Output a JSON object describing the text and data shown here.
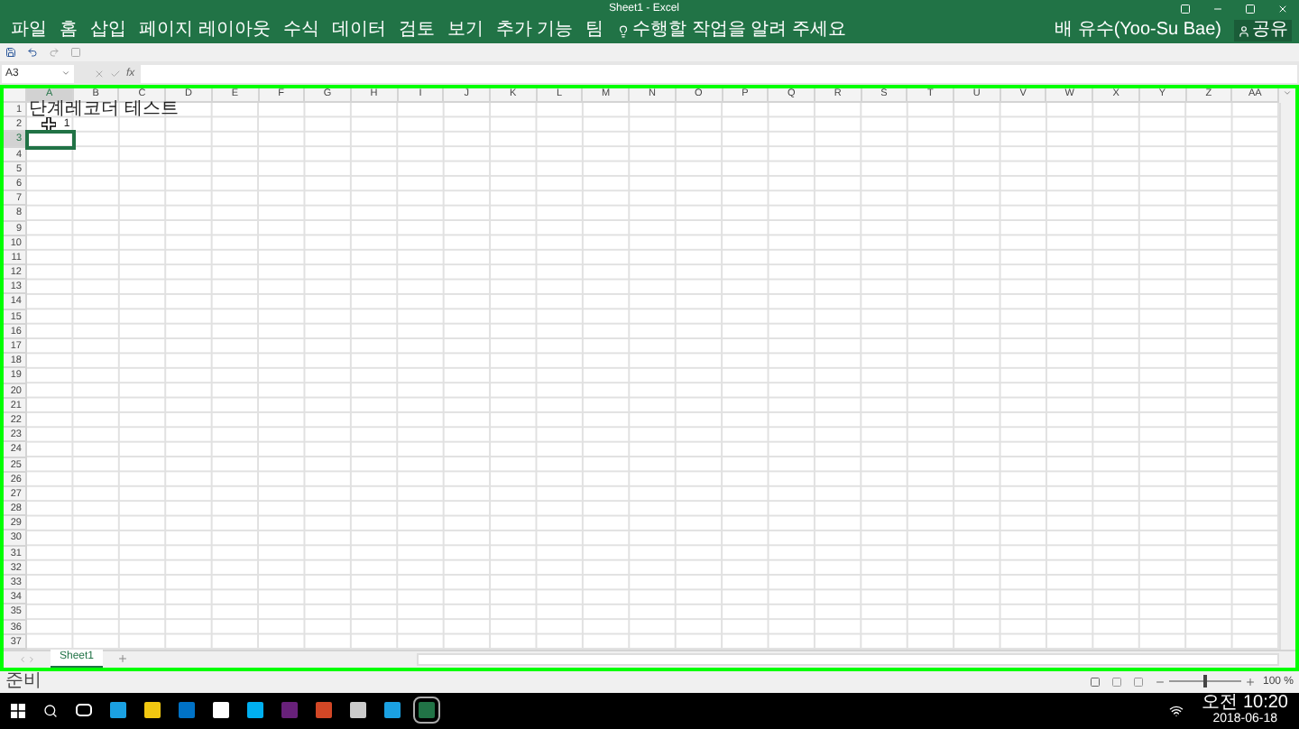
{
  "window": {
    "title": "Sheet1 - Excel",
    "user": "배 유수(Yoo-Su Bae)",
    "share": "공유"
  },
  "ribbon_tabs": [
    "파일",
    "홈",
    "삽입",
    "페이지 레이아웃",
    "수식",
    "데이터",
    "검토",
    "보기",
    "추가 기능",
    "팀"
  ],
  "tell_me": "수행할 작업을 알려 주세요",
  "name_box": "A3",
  "function_label": "fx",
  "columns": [
    {
      "label": "A",
      "selected": true
    },
    {
      "label": "B",
      "selected": false
    },
    {
      "label": "C",
      "selected": false
    },
    {
      "label": "D",
      "selected": false
    },
    {
      "label": "E",
      "selected": false
    },
    {
      "label": "F",
      "selected": false
    },
    {
      "label": "G",
      "selected": false
    },
    {
      "label": "H",
      "selected": false
    },
    {
      "label": "I",
      "selected": false
    },
    {
      "label": "J",
      "selected": false
    },
    {
      "label": "K",
      "selected": false
    },
    {
      "label": "L",
      "selected": false
    },
    {
      "label": "M",
      "selected": false
    },
    {
      "label": "N",
      "selected": false
    },
    {
      "label": "O",
      "selected": false
    },
    {
      "label": "P",
      "selected": false
    },
    {
      "label": "Q",
      "selected": false
    },
    {
      "label": "R",
      "selected": false
    },
    {
      "label": "S",
      "selected": false
    },
    {
      "label": "T",
      "selected": false
    },
    {
      "label": "U",
      "selected": false
    },
    {
      "label": "V",
      "selected": false
    },
    {
      "label": "W",
      "selected": false
    },
    {
      "label": "X",
      "selected": false
    },
    {
      "label": "Y",
      "selected": false
    },
    {
      "label": "Z",
      "selected": false
    },
    {
      "label": "AA",
      "selected": false
    }
  ],
  "rows": [
    {
      "header": "1",
      "selected": false,
      "cells": [
        {
          "kind": "text",
          "value": "단계레코더 테스트"
        }
      ]
    },
    {
      "header": "2",
      "selected": false,
      "cells": [
        {
          "kind": "number",
          "value": "1"
        }
      ]
    },
    {
      "header": "3",
      "selected": true
    },
    {
      "header": "4",
      "selected": false
    },
    {
      "header": "5",
      "selected": false
    },
    {
      "header": "6",
      "selected": false
    },
    {
      "header": "7",
      "selected": false
    },
    {
      "header": "8",
      "selected": false
    },
    {
      "header": "9",
      "selected": false
    },
    {
      "header": "10",
      "selected": false
    },
    {
      "header": "11",
      "selected": false
    },
    {
      "header": "12",
      "selected": false
    },
    {
      "header": "13",
      "selected": false
    },
    {
      "header": "14",
      "selected": false
    },
    {
      "header": "15",
      "selected": false
    },
    {
      "header": "16",
      "selected": false
    },
    {
      "header": "17",
      "selected": false
    },
    {
      "header": "18",
      "selected": false
    },
    {
      "header": "19",
      "selected": false
    },
    {
      "header": "20",
      "selected": false
    },
    {
      "header": "21",
      "selected": false
    },
    {
      "header": "22",
      "selected": false
    },
    {
      "header": "23",
      "selected": false
    },
    {
      "header": "24",
      "selected": false
    },
    {
      "header": "25",
      "selected": false
    },
    {
      "header": "26",
      "selected": false
    },
    {
      "header": "27",
      "selected": false
    },
    {
      "header": "28",
      "selected": false
    },
    {
      "header": "29",
      "selected": false
    },
    {
      "header": "30",
      "selected": false
    },
    {
      "header": "31",
      "selected": false
    },
    {
      "header": "32",
      "selected": false
    },
    {
      "header": "33",
      "selected": false
    },
    {
      "header": "34",
      "selected": false
    },
    {
      "header": "35",
      "selected": false
    },
    {
      "header": "36",
      "selected": false
    },
    {
      "header": "37",
      "selected": false
    }
  ],
  "sheet_tabs": [
    {
      "label": "Sheet1",
      "selected": true
    }
  ],
  "status_bar": {
    "status": "준비",
    "zoom": "100 %",
    "zoom_slider": {
      "level": 0.5
    }
  },
  "taskbar": {
    "time": "오전 10:20",
    "date": "2018-06-18"
  }
}
